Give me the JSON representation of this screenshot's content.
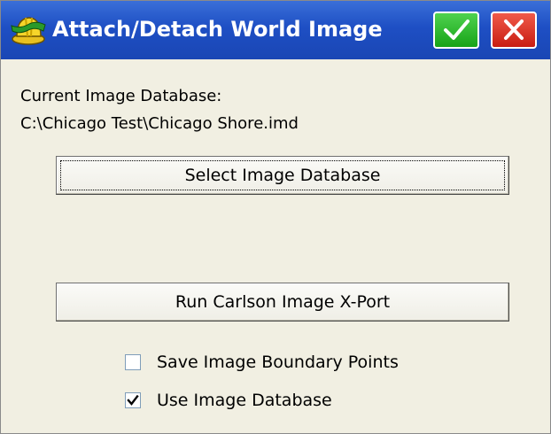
{
  "window": {
    "title": "Attach/Detach World Image",
    "ok_icon": "checkmark-icon",
    "cancel_icon": "close-icon"
  },
  "content": {
    "current_db_label": "Current Image Database:",
    "current_db_path": "C:\\Chicago Test\\Chicago Shore.imd",
    "select_db_button": "Select Image Database",
    "run_xport_button": "Run Carlson Image X-Port",
    "options": [
      {
        "label": "Save Image Boundary Points",
        "checked": false
      },
      {
        "label": "Use Image Database",
        "checked": true
      }
    ]
  },
  "colors": {
    "titlebar": "#1e4fc4",
    "ok": "#17a317",
    "cancel": "#c81d12",
    "background": "#f1efe2"
  }
}
